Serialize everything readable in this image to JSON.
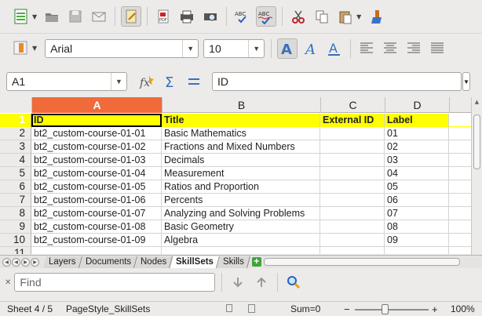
{
  "toolbar1": {
    "buttons": [
      "new-icon",
      "open-icon",
      "save-icon",
      "email-icon",
      "edit-file-icon",
      "export-pdf-icon",
      "print-icon",
      "print-preview-icon",
      "spellcheck-icon",
      "autospellcheck-icon",
      "cut-icon",
      "copy-icon",
      "paste-icon",
      "clone-format-icon"
    ]
  },
  "formatting": {
    "font_name": "Arial",
    "font_size": "10"
  },
  "formula_bar": {
    "cell_ref": "A1",
    "content": "ID"
  },
  "columns": [
    "A",
    "B",
    "C",
    "D"
  ],
  "rows": [
    {
      "num": "1",
      "cells": [
        "ID",
        "Title",
        "External ID",
        "Label"
      ]
    },
    {
      "num": "2",
      "cells": [
        "bt2_custom-course-01-01",
        "Basic Mathematics",
        "",
        "01"
      ]
    },
    {
      "num": "3",
      "cells": [
        "bt2_custom-course-01-02",
        "Fractions and Mixed Numbers",
        "",
        "02"
      ]
    },
    {
      "num": "4",
      "cells": [
        "bt2_custom-course-01-03",
        "Decimals",
        "",
        "03"
      ]
    },
    {
      "num": "5",
      "cells": [
        "bt2_custom-course-01-04",
        "Measurement",
        "",
        "04"
      ]
    },
    {
      "num": "6",
      "cells": [
        "bt2_custom-course-01-05",
        "Ratios and Proportion",
        "",
        "05"
      ]
    },
    {
      "num": "7",
      "cells": [
        "bt2_custom-course-01-06",
        "Percents",
        "",
        "06"
      ]
    },
    {
      "num": "8",
      "cells": [
        "bt2_custom-course-01-07",
        "Analyzing and Solving Problems",
        "",
        "07"
      ]
    },
    {
      "num": "9",
      "cells": [
        "bt2_custom-course-01-08",
        "Basic Geometry",
        "",
        "08"
      ]
    },
    {
      "num": "10",
      "cells": [
        "bt2_custom-course-01-09",
        "Algebra",
        "",
        "09"
      ]
    },
    {
      "num": "11",
      "cells": [
        "",
        "",
        "",
        ""
      ]
    }
  ],
  "sheet_tabs": [
    "Layers",
    "Documents",
    "Nodes",
    "SkillSets",
    "Skills"
  ],
  "active_tab": "SkillSets",
  "find": {
    "placeholder": "Find"
  },
  "status": {
    "sheet": "Sheet 4 / 5",
    "page_style": "PageStyle_SkillSets",
    "sum": "Sum=0",
    "zoom": "100%"
  },
  "colors": {
    "header_fill": "#ffff00",
    "selection": "#f06a3a"
  }
}
